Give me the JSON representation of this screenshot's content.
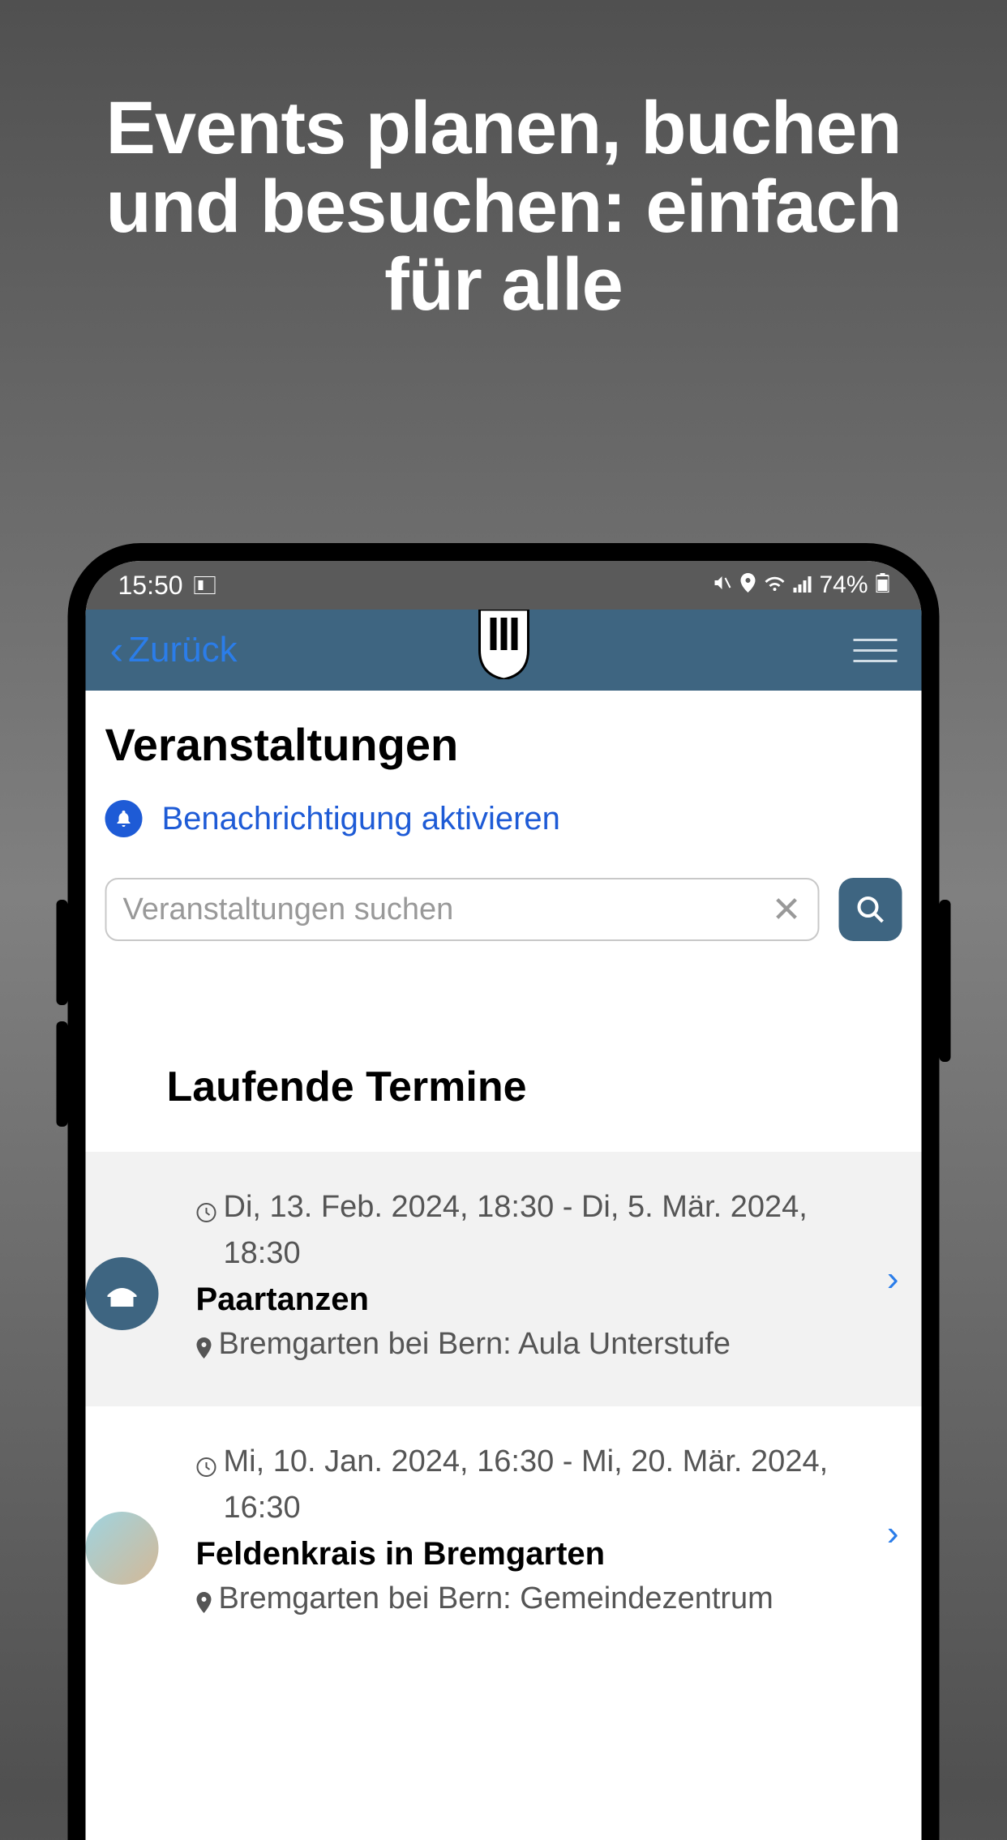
{
  "promo": {
    "title": "Events planen, buchen und besuchen: einfach für alle"
  },
  "status_bar": {
    "time": "15:50",
    "battery": "74%"
  },
  "header": {
    "back_label": "Zurück"
  },
  "page": {
    "title": "Veranstaltungen",
    "notification_label": "Benachrichtigung aktivieren",
    "search_placeholder": "Veranstaltungen suchen",
    "section_title": "Laufende Termine"
  },
  "events": [
    {
      "date": "Di, 13. Feb. 2024, 18:30 - Di, 5. Mär. 2024, 18:30",
      "title": "Paartanzen",
      "location": "Bremgarten bei Bern: Aula Unterstufe",
      "icon": "tent"
    },
    {
      "date": "Mi, 10. Jan. 2024, 16:30 - Mi, 20. Mär. 2024, 16:30",
      "title": "Feldenkrais in Bremgarten",
      "location": "Bremgarten bei Bern: Gemeindezentrum",
      "icon": "image"
    }
  ]
}
